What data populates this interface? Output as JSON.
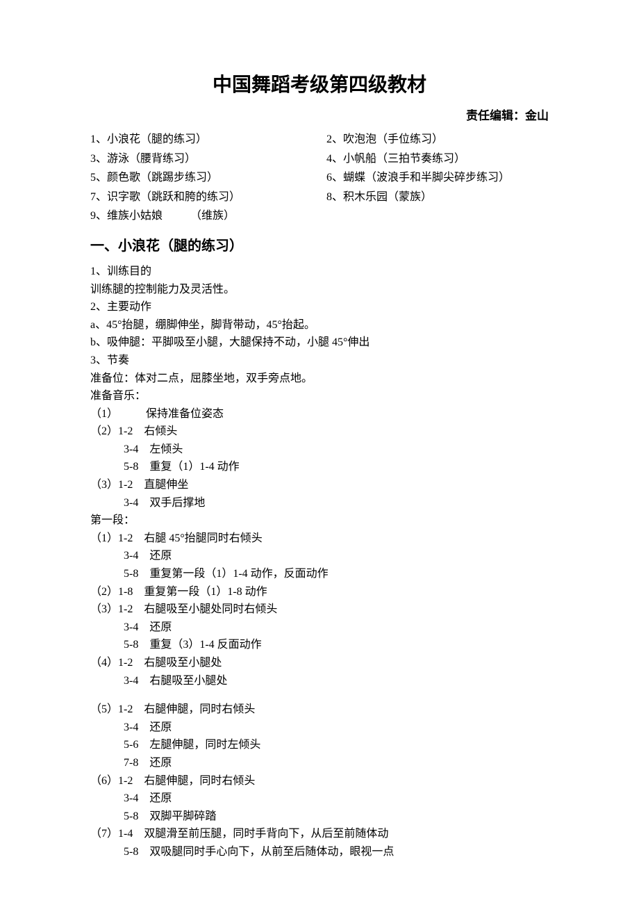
{
  "title": "中国舞蹈考级第四级教材",
  "editor": "责任编辑：金山",
  "toc": [
    "1、小浪花（腿的练习）",
    "2、吹泡泡（手位练习）",
    "3、游泳（腰背练习）",
    "4、小帆船（三拍节奏练习）",
    "5、颜色歌（跳踢步练习）",
    "6、蝴蝶（波浪手和半脚尖碎步练习）",
    "7、识字歌（跳跃和胯的练习）",
    "8、积木乐园（蒙族）",
    "9、维族小姑娘　　　（维族）"
  ],
  "section1": {
    "heading": "一、小浪花（腿的练习）",
    "lines": [
      "1、训练目的",
      "训练腿的控制能力及灵活性。",
      "2、主要动作",
      "a、45°抬腿，绷脚伸坐，脚背带动，45°抬起。",
      "b、吸伸腿：平脚吸至小腿，大腿保持不动，小腿 45°伸出",
      "3、节奏",
      "准备位：体对二点，屈膝坐地，双手旁点地。",
      "准备音乐：",
      "（1）　　　保持准备位姿态",
      "（2）1-2　右倾头",
      "　　　3-4　左倾头",
      "　　　5-8　重复（1）1-4 动作",
      "（3）1-2　直腿伸坐",
      "　　　3-4　双手后撑地",
      "第一段：",
      "（1）1-2　右腿 45°抬腿同时右倾头",
      "　　　3-4　还原",
      "　　　5-8　重复第一段（1）1-4 动作，反面动作",
      "（2）1-8　重复第一段（1）1-8 动作",
      "（3）1-2　右腿吸至小腿处同时右倾头",
      "　　　3-4　还原",
      "　　　5-8　重复（3）1-4 反面动作",
      "（4）1-2　右腿吸至小腿处",
      "　　　3-4　右腿吸至小腿处",
      "",
      "（5）1-2　右腿伸腿，同时右倾头",
      "　　　3-4　还原",
      "　　　5-6　左腿伸腿，同时左倾头",
      "　　　7-8　还原",
      "（6）1-2　右腿伸腿，同时右倾头",
      "　　　3-4　还原",
      "　　　5-8　双脚平脚碎踏",
      "（7）1-4　双腿滑至前压腿，同时手背向下，从后至前随体动",
      "　　　5-8　双吸腿同时手心向下，从前至后随体动，眼视一点"
    ]
  }
}
